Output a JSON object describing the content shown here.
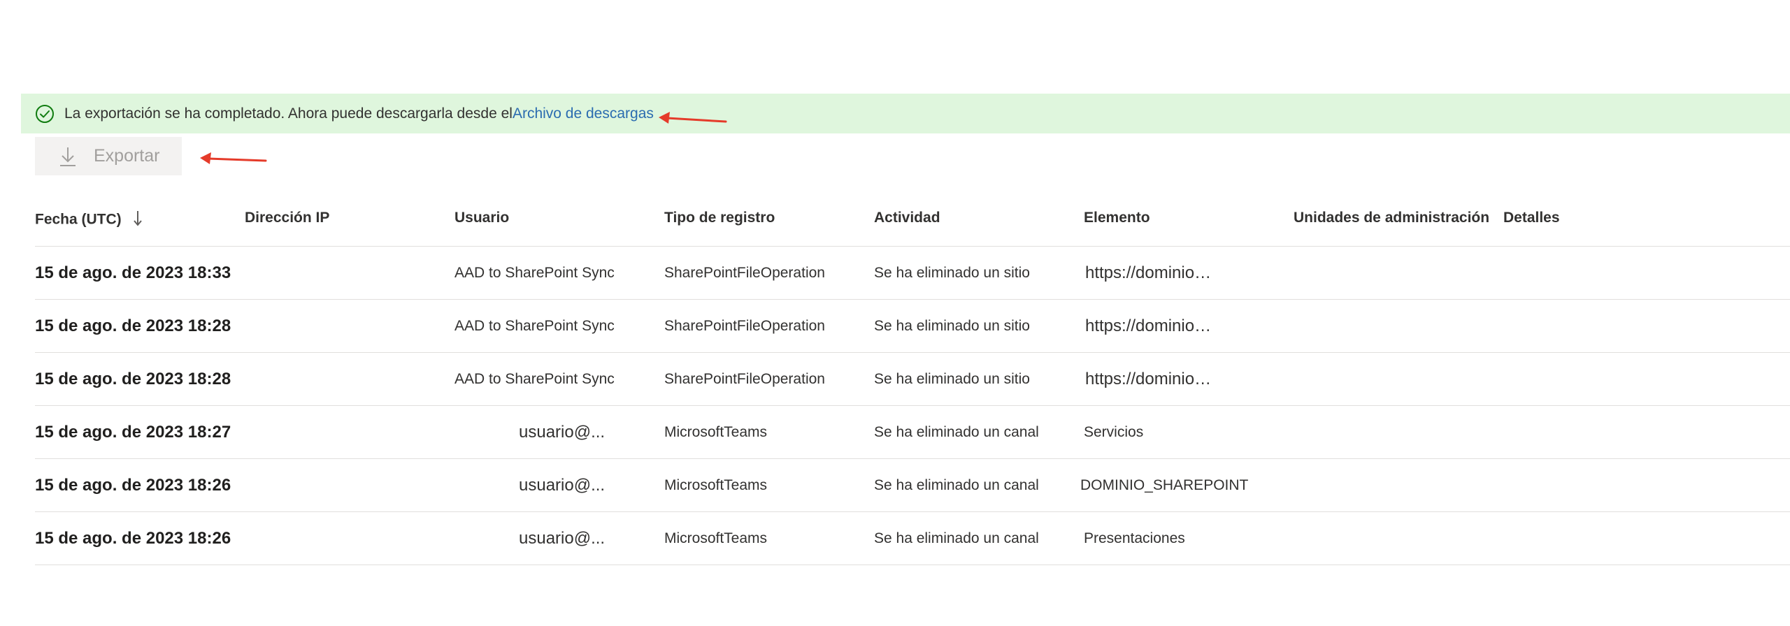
{
  "banner": {
    "message": "La exportación se ha completado. Ahora puede descargarla desde el",
    "link": "Archivo de descargas",
    "icon": "checkmark-circle-icon",
    "color": "#dff6dd"
  },
  "toolbar": {
    "export_label": "Exportar",
    "export_icon": "download-icon"
  },
  "table": {
    "columns": [
      "Fecha (UTC)",
      "Dirección IP",
      "Usuario",
      "Tipo de registro",
      "Actividad",
      "Elemento",
      "Unidades de administración",
      "Detalles"
    ],
    "sort_icon": "arrow-down-icon",
    "rows": [
      {
        "date": "15 de ago. de 2023 18:33",
        "ip": "",
        "user": "AAD to SharePoint Sync",
        "type": "SharePointFileOperation",
        "activity": "Se ha eliminado un sitio",
        "item": "https://dominio…",
        "units": "",
        "details": ""
      },
      {
        "date": "15 de ago. de 2023 18:28",
        "ip": "",
        "user": "AAD to SharePoint Sync",
        "type": "SharePointFileOperation",
        "activity": "Se ha eliminado un sitio",
        "item": "https://dominio…",
        "units": "",
        "details": ""
      },
      {
        "date": "15 de ago. de 2023 18:28",
        "ip": "",
        "user": "AAD to SharePoint Sync",
        "type": "SharePointFileOperation",
        "activity": "Se ha eliminado un sitio",
        "item": "https://dominio…",
        "units": "",
        "details": ""
      },
      {
        "date": "15 de ago. de 2023 18:27",
        "ip": "",
        "user": "usuario@...",
        "type": "MicrosoftTeams",
        "activity": "Se ha eliminado un canal",
        "item": "Servicios",
        "units": "",
        "details": ""
      },
      {
        "date": "15 de ago. de 2023 18:26",
        "ip": "",
        "user": "usuario@...",
        "type": "MicrosoftTeams",
        "activity": "Se ha eliminado un canal",
        "item": "DOMINIO_SHAREPOINT",
        "units": "",
        "details": ""
      },
      {
        "date": "15 de ago. de 2023 18:26",
        "ip": "",
        "user": "usuario@...",
        "type": "MicrosoftTeams",
        "activity": "Se ha eliminado un canal",
        "item": "Presentaciones",
        "units": "",
        "details": ""
      }
    ]
  },
  "colors": {
    "annotation_arrow": "#e53b2a",
    "link": "#2b6cb0"
  }
}
